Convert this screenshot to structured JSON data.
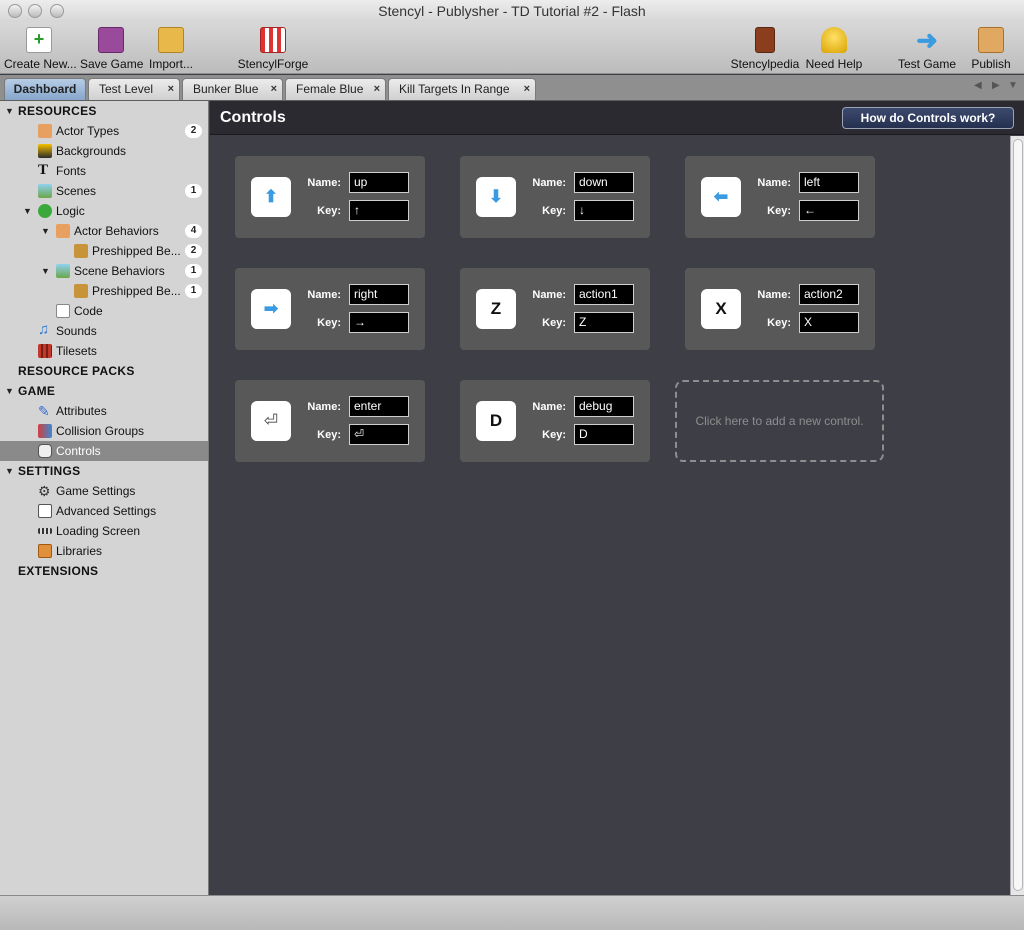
{
  "window": {
    "title": "Stencyl - Publysher - TD Tutorial #2 - Flash"
  },
  "toolbar": {
    "create_new": "Create New...",
    "save_game": "Save Game",
    "import": "Import...",
    "stencylforge": "StencylForge",
    "stencylpedia": "Stencylpedia",
    "need_help": "Need Help",
    "test_game": "Test Game",
    "publish": "Publish"
  },
  "tabs": [
    "Dashboard",
    "Test Level",
    "Bunker Blue",
    "Female Blue",
    "Kill Targets In Range"
  ],
  "tab_close": "×",
  "sidebar": {
    "resources": "RESOURCES",
    "actor_types": "Actor Types",
    "actor_types_count": "2",
    "backgrounds": "Backgrounds",
    "fonts": "Fonts",
    "scenes": "Scenes",
    "scenes_count": "1",
    "logic": "Logic",
    "actor_behaviors": "Actor Behaviors",
    "actor_behaviors_count": "4",
    "preshipped_actor": "Preshipped Be...",
    "preshipped_actor_count": "2",
    "scene_behaviors": "Scene Behaviors",
    "scene_behaviors_count": "1",
    "preshipped_scene": "Preshipped Be...",
    "preshipped_scene_count": "1",
    "code": "Code",
    "sounds": "Sounds",
    "tilesets": "Tilesets",
    "resource_packs": "RESOURCE PACKS",
    "game": "GAME",
    "attributes": "Attributes",
    "collision_groups": "Collision Groups",
    "controls": "Controls",
    "settings": "SETTINGS",
    "game_settings": "Game Settings",
    "advanced_settings": "Advanced Settings",
    "loading_screen": "Loading Screen",
    "libraries": "Libraries",
    "extensions": "EXTENSIONS"
  },
  "main": {
    "title": "Controls",
    "help_button": "How do Controls work?",
    "name_label": "Name:",
    "key_label": "Key:",
    "add_control": "Click here to add a new control.",
    "controls": [
      {
        "icon": "⬆",
        "name": "up",
        "key": "↑"
      },
      {
        "icon": "⬇",
        "name": "down",
        "key": "↓"
      },
      {
        "icon": "⬅",
        "name": "left",
        "key": "←"
      },
      {
        "icon": "➡",
        "name": "right",
        "key": "→"
      },
      {
        "icon": "Z",
        "name": "action1",
        "key": "Z"
      },
      {
        "icon": "X",
        "name": "action2",
        "key": "X"
      },
      {
        "icon": "⏎",
        "name": "enter",
        "key": "⏎"
      },
      {
        "icon": "D",
        "name": "debug",
        "key": "D"
      }
    ]
  },
  "colors": {
    "accent_arrow": "#3a9be0",
    "selected_row": "#8a8a8a",
    "panel_bg": "#3e3e47",
    "card_bg": "#585858"
  }
}
